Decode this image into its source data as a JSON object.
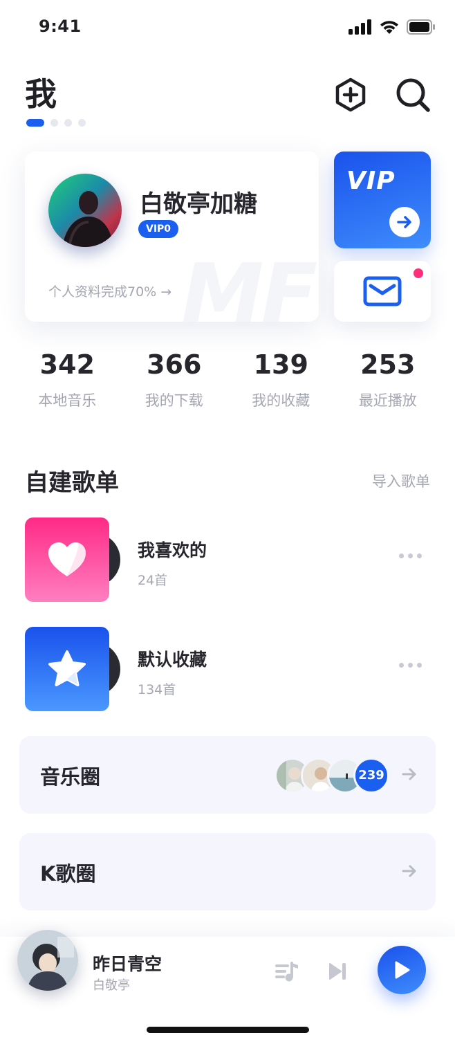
{
  "status_bar": {
    "time": "9:41"
  },
  "header": {
    "title": "我",
    "add_icon": "hexagon-plus-icon",
    "search_icon": "search-icon",
    "page_count": 4,
    "active_page": 1
  },
  "profile": {
    "name": "白敬亭加糖",
    "vip_level": "VIP0",
    "completion": "个人资料完成70% →",
    "watermark": "MF"
  },
  "vip_card": {
    "title": "VIP",
    "arrow_icon": "arrow-right-icon"
  },
  "messages": {
    "icon": "mail-icon",
    "has_unread": true
  },
  "stats": [
    {
      "value": "342",
      "label": "本地音乐"
    },
    {
      "value": "366",
      "label": "我的下载"
    },
    {
      "value": "139",
      "label": "我的收藏"
    },
    {
      "value": "253",
      "label": "最近播放"
    }
  ],
  "playlists_section": {
    "title": "自建歌单",
    "import_label": "导入歌单",
    "items": [
      {
        "name": "我喜欢的",
        "count": "24首",
        "icon": "heart-icon"
      },
      {
        "name": "默认收藏",
        "count": "134首",
        "icon": "star-icon"
      }
    ]
  },
  "circles": [
    {
      "label": "音乐圈",
      "member_count": "239"
    },
    {
      "label": "K歌圈"
    }
  ],
  "player": {
    "title": "昨日青空",
    "artist": "白敬亭",
    "playlist_icon": "playlist-icon",
    "next_icon": "skip-next-icon",
    "play_icon": "play-icon"
  },
  "colors": {
    "accent": "#1a5ff0",
    "pink": "#ff2a86",
    "text": "#26262c",
    "muted": "#a4a7b2",
    "panel": "#f5f6fd"
  }
}
